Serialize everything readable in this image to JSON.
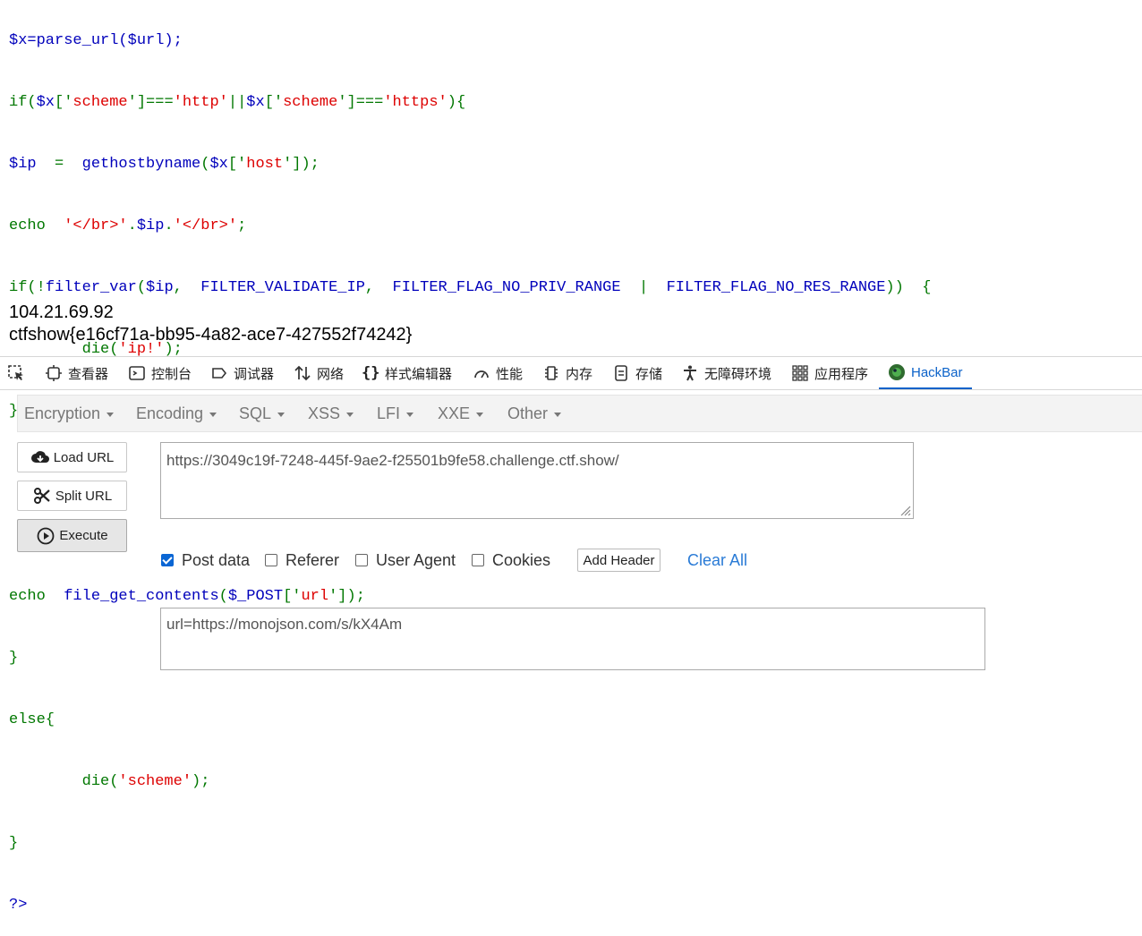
{
  "code": {
    "l0": "$x=parse_url($url);",
    "l1": [
      "if(",
      "$x",
      "['",
      "scheme",
      "']===",
      "'http'",
      "||",
      "$x",
      "['",
      "scheme",
      "']===",
      "'https'",
      "){"
    ],
    "l2": [
      "$ip",
      "  =  ",
      "gethostbyname",
      "(",
      "$x",
      "['",
      "host",
      "']);"
    ],
    "l3": [
      "echo  ",
      "'</br>'",
      ".",
      "$ip",
      ".",
      "'</br>'",
      ";"
    ],
    "l4": [
      "if(!",
      "filter_var",
      "(",
      "$ip",
      ",  ",
      "FILTER_VALIDATE_IP",
      ",  ",
      "FILTER_FLAG_NO_PRIV_RANGE",
      "  |  ",
      "FILTER_FLAG_NO_RES_RANGE",
      "))  {"
    ],
    "l5": [
      "        die(",
      "'ip!'",
      ");"
    ],
    "l6": "}",
    "l9": [
      "echo  ",
      "file_get_contents",
      "(",
      "$_POST",
      "['",
      "url",
      "']);"
    ],
    "l10": "}",
    "l11": "else{",
    "l12": [
      "        die(",
      "'scheme'",
      ");"
    ],
    "l13": "}",
    "l14": "?>"
  },
  "output": {
    "ip": "104.21.69.92",
    "flag": "ctfshow{e16cf71a-bb95-4a82-ace7-427552f74242}"
  },
  "devtools": {
    "tabs": [
      "查看器",
      "控制台",
      "调试器",
      "网络",
      "样式编辑器",
      "性能",
      "内存",
      "存储",
      "无障碍环境",
      "应用程序",
      "HackBar"
    ],
    "accent": "#0b62c9"
  },
  "hackbar": {
    "menu": [
      "Encryption",
      "Encoding",
      "SQL",
      "XSS",
      "LFI",
      "XXE",
      "Other"
    ],
    "load_url": "Load URL",
    "split_url": "Split URL",
    "execute": "Execute",
    "url_value": "https://3049c19f-7248-445f-9ae2-f25501b9fe58.challenge.ctf.show/",
    "options": {
      "post_data": "Post data",
      "referer": "Referer",
      "user_agent": "User Agent",
      "cookies": "Cookies"
    },
    "post_checked": true,
    "add_header": "Add Header",
    "clear_all": "Clear All",
    "post_value": "url=https://monojson.com/s/kX4Am"
  }
}
